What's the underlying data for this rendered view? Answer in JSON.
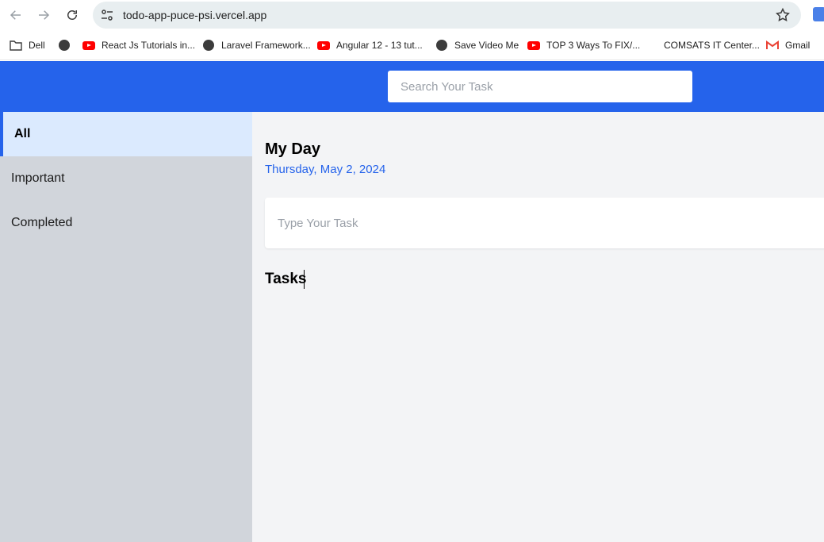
{
  "browser": {
    "url": "todo-app-puce-psi.vercel.app",
    "bookmarks": [
      {
        "label": "Dell",
        "icon": "folder-icon"
      },
      {
        "label": "",
        "icon": "globe-icon"
      },
      {
        "label": "React Js Tutorials in...",
        "icon": "youtube-icon"
      },
      {
        "label": "Laravel Framework...",
        "icon": "globe-icon"
      },
      {
        "label": "Angular 12 - 13 tut...",
        "icon": "youtube-icon"
      },
      {
        "label": "Save Video Me",
        "icon": "globe-icon"
      },
      {
        "label": "TOP 3 Ways To FIX/...",
        "icon": "youtube-icon"
      },
      {
        "label": "COMSATS IT Center...",
        "icon": "none"
      },
      {
        "label": "Gmail",
        "icon": "gmail-icon"
      }
    ]
  },
  "header": {
    "search_placeholder": "Search Your Task",
    "color": "#2563eb"
  },
  "sidebar": {
    "items": [
      {
        "label": "All",
        "active": true
      },
      {
        "label": "Important",
        "active": false
      },
      {
        "label": "Completed",
        "active": false
      }
    ]
  },
  "main": {
    "title": "My Day",
    "date": "Thursday, May 2, 2024",
    "task_placeholder": "Type Your Task",
    "tasks_heading": "Tasks"
  }
}
